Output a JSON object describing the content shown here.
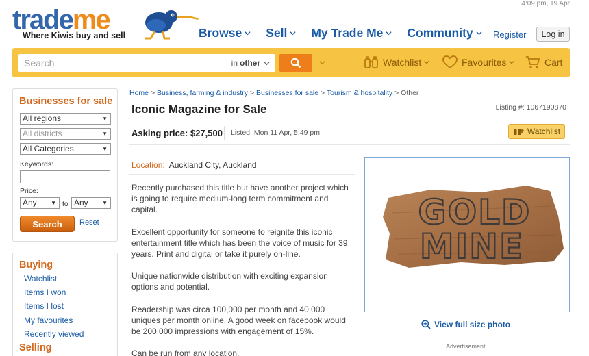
{
  "header": {
    "timestamp": "4:09 pm, 19 Apr",
    "logo": {
      "word_part1": "trade",
      "word_part2": "me",
      "tagline": "Where Kiwis buy and sell"
    },
    "nav": [
      {
        "label": "Browse"
      },
      {
        "label": "Sell"
      },
      {
        "label": "My Trade Me"
      },
      {
        "label": "Community"
      }
    ],
    "register_label": "Register",
    "login_label": "Log in"
  },
  "search": {
    "placeholder": "Search",
    "category_prefix": "in",
    "category_value": "other",
    "watchlist_label": "Watchlist",
    "favourites_label": "Favourites",
    "cart_label": "Cart"
  },
  "sidebar": {
    "title": "Businesses for sale",
    "region": "All regions",
    "district": "All districts",
    "categories": "All Categories",
    "keywords_label": "Keywords:",
    "price_label": "Price:",
    "price_from": "Any",
    "price_to_label": "to",
    "price_to": "Any",
    "search_label": "Search",
    "reset_label": "Reset",
    "buying_title": "Buying",
    "buying_links": [
      "Watchlist",
      "Items I won",
      "Items I lost",
      "My favourites",
      "Recently viewed"
    ],
    "selling_title": "Selling"
  },
  "breadcrumb": {
    "home": "Home",
    "sep": ">",
    "items": [
      "Business, farming & industry",
      "Businesses for sale",
      "Tourism & hospitality"
    ],
    "current": "Other"
  },
  "listing": {
    "title": "Iconic Magazine for Sale",
    "number": "Listing #: 1067190870",
    "asking_price": "Asking price: $27,500",
    "listed": "Listed: Mon 11 Apr, 5:49 pm",
    "watchlist_button": "Watchlist",
    "location_label": "Location:",
    "location_value": "Auckland City, Auckland",
    "paragraphs": [
      "Recently purchased this title but have another project which is going to require medium-long term commitment and capital.",
      "Excellent opportunity for someone to reignite this iconic entertainment title which has been the voice of music for 39 years. Print and digital or take it purely on-line.",
      "Unique nationwide distribution with exciting expansion options and potential.",
      "Readership was circa 100,000 per month and 40,000 uniques per month online. A good week on facebook would be 200,000 impressions with engagement of 15%.",
      "Can be run from any location."
    ],
    "photo_text_line1": "GOLD",
    "photo_text_line2": "MINE",
    "view_photo_label": "View full size photo",
    "advertisement_label": "Advertisement"
  },
  "colors": {
    "brand_blue": "#1a5ba6",
    "brand_orange": "#ee7e1a",
    "search_bar": "#f6c343"
  }
}
